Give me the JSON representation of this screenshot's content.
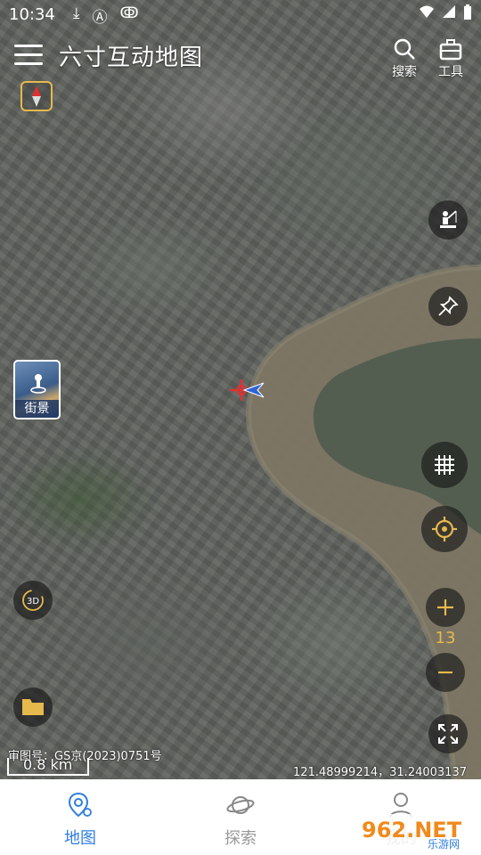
{
  "status_bar": {
    "time": "10:34",
    "icons": [
      "download-icon",
      "font-icon",
      "bug-icon"
    ],
    "right_icons": [
      "wifi-icon",
      "signal-icon",
      "battery-icon"
    ]
  },
  "header": {
    "title": "六寸互动地图",
    "actions": [
      {
        "label": "搜索",
        "icon": "search-icon"
      },
      {
        "label": "工具",
        "icon": "toolbox-icon"
      }
    ]
  },
  "map": {
    "street_view_label": "街景",
    "zoom_level": "13",
    "approval_number": "审图号：GS京(2023)0751号",
    "scale_label": "0.8 km",
    "coordinates": "121.48999214，31.24003137",
    "three_d_label": "3D"
  },
  "bottom_nav": {
    "items": [
      {
        "label": "地图",
        "active": true
      },
      {
        "label": "探索",
        "active": false
      },
      {
        "label": "我的",
        "active": false
      }
    ]
  },
  "watermark": {
    "brand": "962.NET",
    "sub": "乐游网"
  },
  "colors": {
    "accent": "#2f7de1",
    "gold": "#e6b94c",
    "nav_inactive": "#999999"
  }
}
